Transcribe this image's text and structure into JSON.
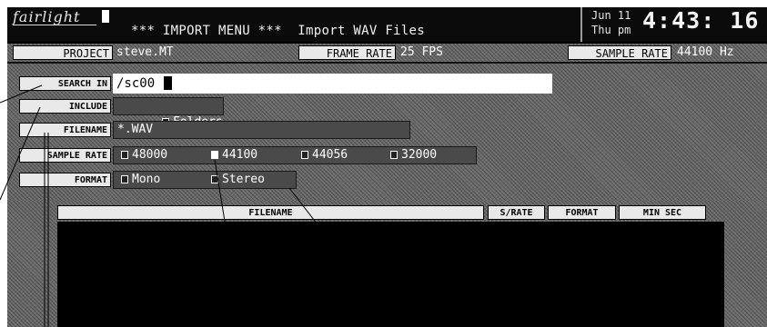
{
  "header": {
    "logo": "fairlight",
    "title": "*** IMPORT MENU ***  Import WAV Files",
    "date_line1": "Jun 11",
    "date_line2": "Thu pm",
    "clock": "4:43: 16"
  },
  "status": {
    "project_label": "PROJECT",
    "project_value": "steve.MT",
    "frame_rate_label": "FRAME RATE",
    "frame_rate_value": "25 FPS",
    "sample_rate_label": "SAMPLE RATE",
    "sample_rate_value": "44100 Hz"
  },
  "form": {
    "search_in_label": "SEARCH IN",
    "search_in_value": "/sc00",
    "include_label": "INCLUDE",
    "include_option": "Folders",
    "filename_label": "FILENAME",
    "filename_value": "*.WAV",
    "sample_rate_label": "SAMPLE RATE",
    "sample_rate_options": [
      "48000",
      "44100",
      "44056",
      "32000"
    ],
    "sample_rate_selected": "44100",
    "format_label": "FORMAT",
    "format_options": [
      "Mono",
      "Stereo"
    ]
  },
  "table": {
    "columns": [
      "FILENAME",
      "S/RATE",
      "FORMAT",
      "MIN SEC"
    ]
  },
  "colors": {
    "background": "#000000",
    "label_bg": "#e9e9e9",
    "panel_hatch": "#6a6a6a",
    "field_bg": "#4a4a4a",
    "text": "#ffffff"
  }
}
